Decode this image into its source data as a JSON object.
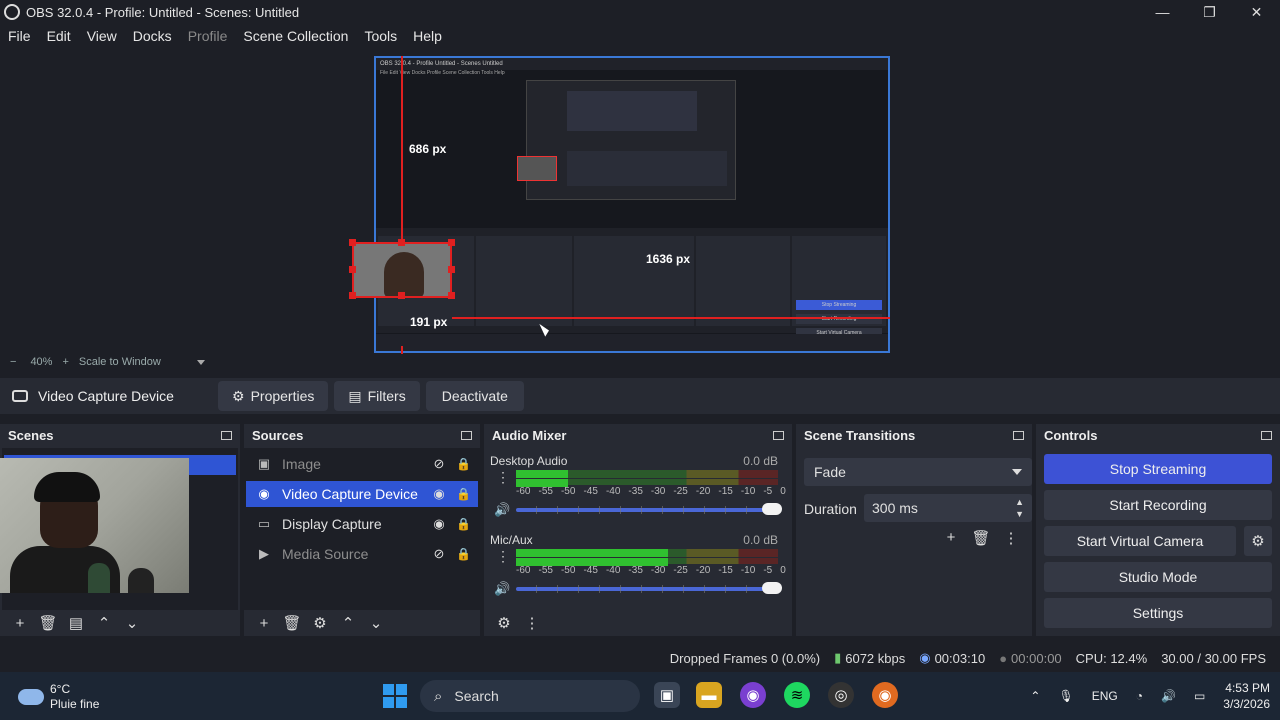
{
  "window": {
    "title": "OBS 32.0.4 - Profile: Untitled - Scenes: Untitled",
    "min": "—",
    "max": "❐",
    "close": "✕"
  },
  "menu": [
    "File",
    "Edit",
    "View",
    "Docks",
    "Profile",
    "Scene Collection",
    "Tools",
    "Help"
  ],
  "preview": {
    "measure_top": "686 px",
    "measure_right": "1636 px",
    "measure_bottom": "191 px",
    "inner_title": "OBS 32.0.4 - Profile Untitled - Scenes Untitled",
    "inner_btns": [
      "Properties",
      "Filters",
      "Deactivate"
    ],
    "inner_docks": [
      "Scenes",
      "Sources",
      "Audio Mixer",
      "Scene Transitions",
      "Controls"
    ],
    "inner_controls": [
      "Stop Streaming",
      "Start Recording",
      "Start Virtual Camera",
      "Studio Mode",
      "Settings"
    ]
  },
  "zoom": {
    "minus": "−",
    "value": "40%",
    "plus": "+",
    "mode": "Scale to Window"
  },
  "source_toolbar": {
    "source_name": "Video Capture Device",
    "properties": "Properties",
    "filters": "Filters",
    "deactivate": "Deactivate"
  },
  "scenes": {
    "title": "Scenes"
  },
  "sources": {
    "title": "Sources",
    "items": [
      {
        "label": "Image",
        "icon": "image-icon",
        "visible": false
      },
      {
        "label": "Video Capture Device",
        "icon": "camera-icon",
        "visible": true
      },
      {
        "label": "Display Capture",
        "icon": "monitor-icon",
        "visible": true
      },
      {
        "label": "Media Source",
        "icon": "play-icon",
        "visible": false
      }
    ]
  },
  "mixer": {
    "title": "Audio Mixer",
    "channels": [
      {
        "name": "Desktop Audio",
        "db": "0.0 dB",
        "level": 0.2
      },
      {
        "name": "Mic/Aux",
        "db": "0.0 dB",
        "level": 0.58
      }
    ],
    "scale": [
      "-60",
      "-55",
      "-50",
      "-45",
      "-40",
      "-35",
      "-30",
      "-25",
      "-20",
      "-15",
      "-10",
      "-5",
      "0"
    ]
  },
  "transitions": {
    "title": "Scene Transitions",
    "selected": "Fade",
    "duration_label": "Duration",
    "duration": "300 ms"
  },
  "controls": {
    "title": "Controls",
    "stop_streaming": "Stop Streaming",
    "start_recording": "Start Recording",
    "start_virtual_camera": "Start Virtual Camera",
    "studio_mode": "Studio Mode",
    "settings": "Settings"
  },
  "status": {
    "dropped": "Dropped Frames 0 (0.0%)",
    "bitrate": "6072 kbps",
    "stream_time": "00:03:10",
    "rec_time": "00:00:00",
    "cpu": "CPU: 12.4%",
    "fps": "30.00 / 30.00 FPS"
  },
  "taskbar": {
    "temp": "6°C",
    "weather": "Pluie fine",
    "search": "Search",
    "lang": "ENG",
    "time": "4:53 PM",
    "date": "3/3/2026"
  },
  "colors": {
    "accent": "#2f55d4",
    "stream_btn": "#3d52d5",
    "selection": "#e02020"
  }
}
